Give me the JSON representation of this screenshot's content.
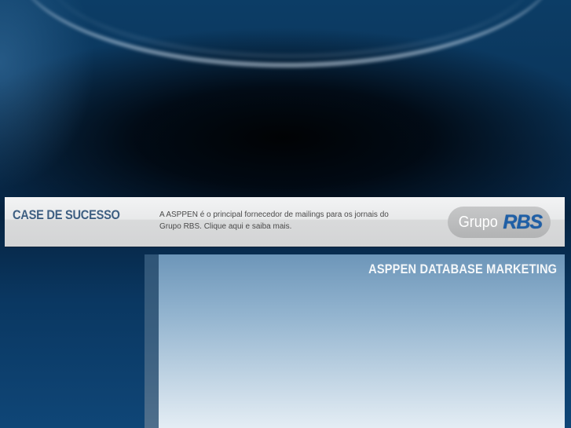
{
  "banner": {
    "title": "CASE DE SUCESSO",
    "description": "A ASPPEN é o principal fornecedor de mailings para os jornais do Grupo RBS. Clique aqui e saiba mais.",
    "logo": {
      "grupo_text": "Grupo",
      "rbs_text": "RBS"
    }
  },
  "panel": {
    "title": "ASPPEN DATABASE MARKETING"
  },
  "colors": {
    "banner_title": "#3e5f82",
    "rbs_blue": "#1f5fa6",
    "rbs_orange": "#e07a18",
    "panel_top": "#6d96b9"
  }
}
